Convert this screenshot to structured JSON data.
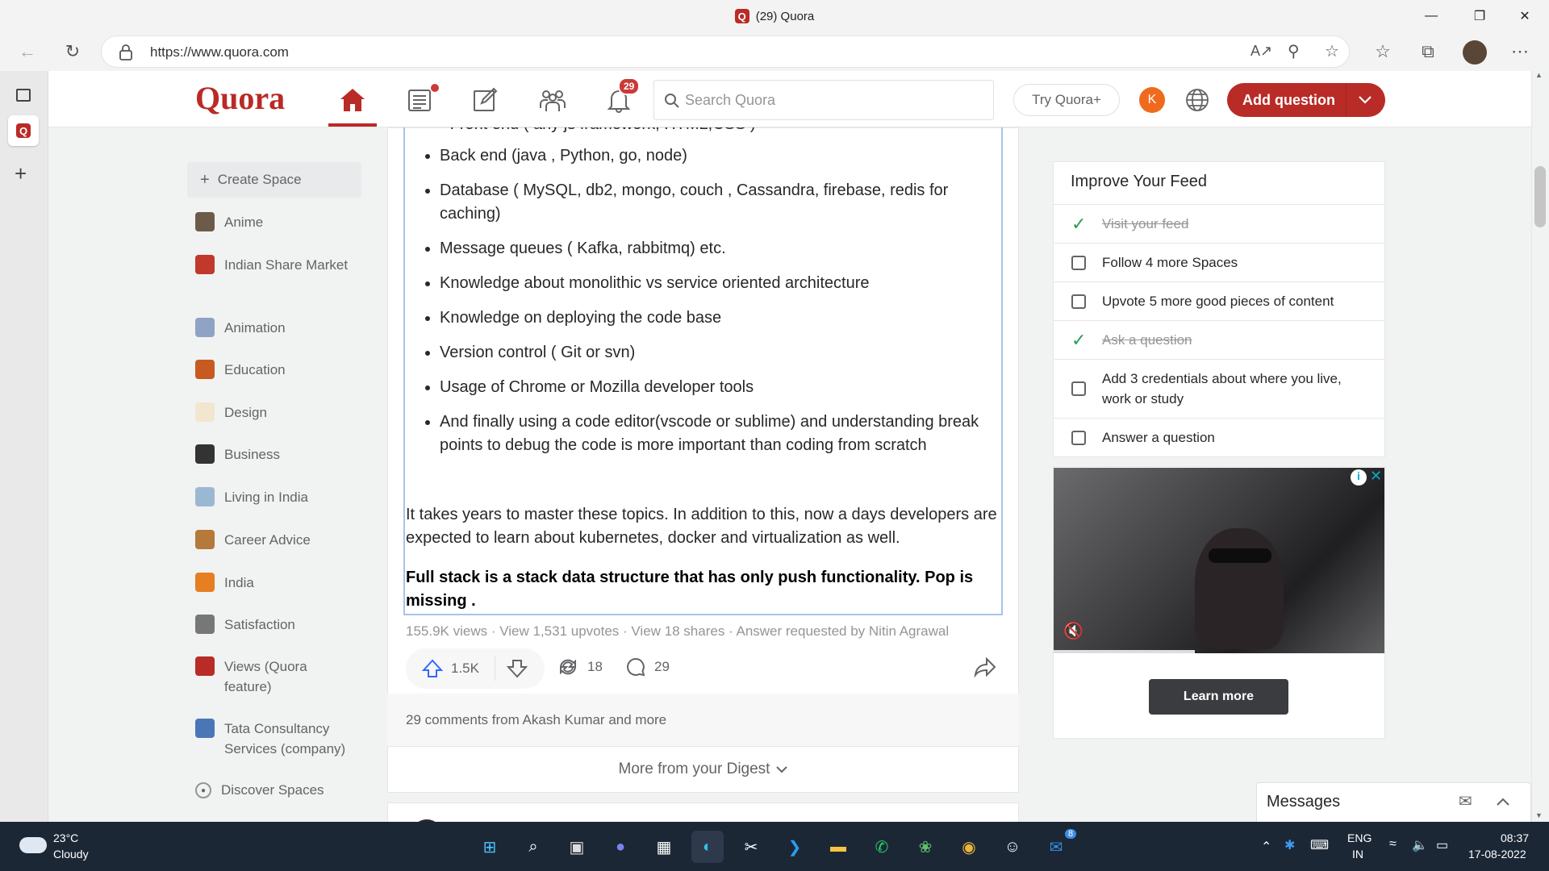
{
  "browser": {
    "tab_title": "(29) Quora",
    "url": "https://www.quora.com"
  },
  "header": {
    "logo": "Quora",
    "notifications_count": "29",
    "search_placeholder": "Search Quora",
    "try_plus": "Try Quora+",
    "avatar_initial": "K",
    "add_question": "Add question"
  },
  "sidebar": {
    "create_space": "Create Space",
    "items": [
      {
        "label": "Anime",
        "color": "#6d5b4a"
      },
      {
        "label": "Indian Share Market",
        "color": "#c0392b"
      },
      {
        "label": "Animation",
        "color": "#8fa3c4"
      },
      {
        "label": "Education",
        "color": "#c65a20"
      },
      {
        "label": "Design",
        "color": "#f2e6cf"
      },
      {
        "label": "Business",
        "color": "#333333"
      },
      {
        "label": "Living in India",
        "color": "#9bb8d3"
      },
      {
        "label": "Career Advice",
        "color": "#b5793b"
      },
      {
        "label": "India",
        "color": "#e67e22"
      },
      {
        "label": "Satisfaction",
        "color": "#777777"
      },
      {
        "label": "Views (Quora feature)",
        "color": "#b92b27"
      },
      {
        "label": "Tata Consultancy Services (company)",
        "color": "#4a76b8"
      }
    ],
    "discover": "Discover Spaces"
  },
  "answer": {
    "partial_top": "Front end ( any js framework, HTML,CSS )",
    "bullets": [
      "Back end (java , Python, go, node)",
      "Database ( MySQL, db2, mongo, couch , Cassandra, firebase, redis for caching)",
      "Message queues ( Kafka, rabbitmq) etc.",
      "Knowledge about monolithic vs service oriented architecture",
      "Knowledge on deploying the code base",
      "Version control ( Git or svn)",
      "Usage of Chrome or Mozilla developer tools",
      "And finally using a code editor(vscode or sublime) and understanding break points to debug the code is more important than coding from scratch"
    ],
    "para1": "It takes years to master these topics. In addition to this, now a days developers are expected to learn about kubernetes, docker and virtualization as well.",
    "para2": "Full stack is a stack data structure that has only push functionality. Pop is missing .",
    "meta": "155.9K views · View 1,531 upvotes · View 18 shares · Answer requested by Nitin Agrawal",
    "upvotes": "1.5K",
    "shares": "18",
    "comments": "29",
    "comments_preview": "29 comments from Akash Kumar and more",
    "more_digest": "More from your Digest"
  },
  "feed": {
    "title": "Improve Your Feed",
    "items": [
      {
        "label": "Visit your feed",
        "done": true
      },
      {
        "label": "Follow 4 more Spaces",
        "done": false
      },
      {
        "label": "Upvote 5 more good pieces of content",
        "done": false
      },
      {
        "label": "Ask a question",
        "done": true
      },
      {
        "label": "Add 3 credentials about where you live, work or study",
        "done": false
      },
      {
        "label": "Answer a question",
        "done": false
      }
    ]
  },
  "ad": {
    "learn_more": "Learn more"
  },
  "messages": {
    "title": "Messages"
  },
  "taskbar": {
    "temp": "23°C",
    "weather": "Cloudy",
    "lang1": "ENG",
    "lang2": "IN",
    "time": "08:37",
    "date": "17-08-2022",
    "mail_badge": "8"
  }
}
